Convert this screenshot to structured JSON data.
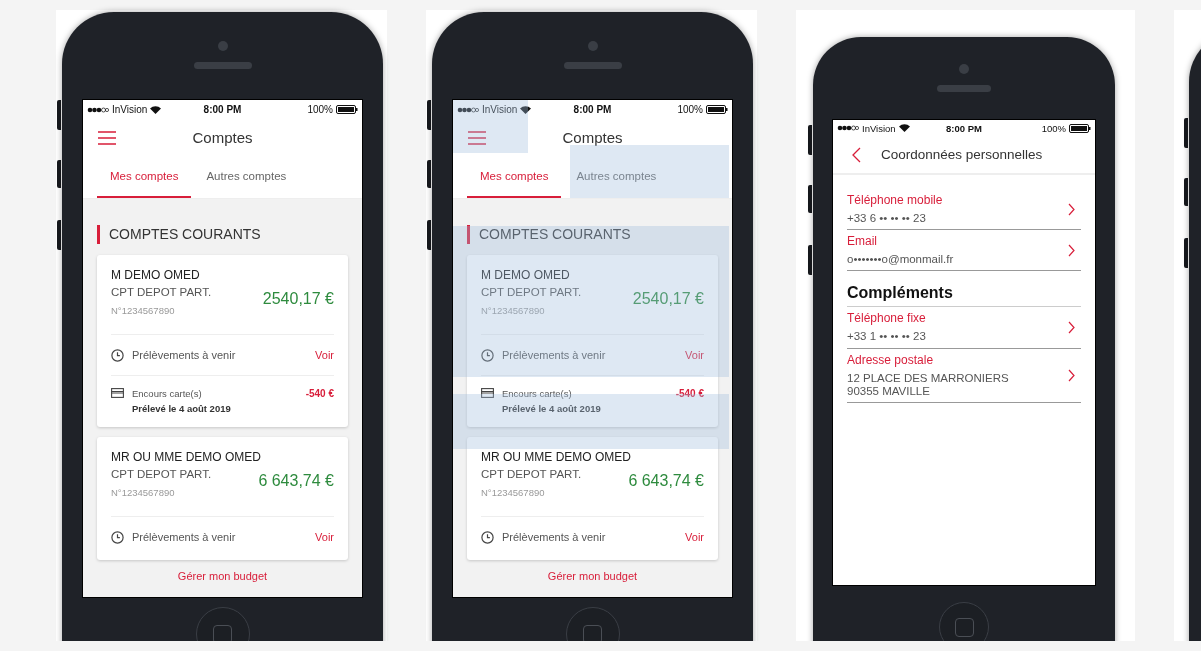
{
  "screens": [
    {
      "kind": "accounts",
      "hotspots_visible": false,
      "status": {
        "carrier": "InVision",
        "time": "8:00 PM",
        "battery": "100%"
      },
      "title": "Comptes",
      "tabs": [
        {
          "label": "Mes comptes",
          "selected": true
        },
        {
          "label": "Autres comptes",
          "selected": false
        }
      ],
      "section_title": "COMPTES COURANTS",
      "accounts": [
        {
          "holder": "M DEMO OMED",
          "type": "CPT DEPOT PART.",
          "balance": "2540,17 €",
          "number": "N°1234567890",
          "rows": [
            {
              "kind": "upcoming",
              "label": "Prélèvements à venir",
              "action": "Voir"
            },
            {
              "kind": "card",
              "label": "Encours carte(s)",
              "amount": "-540 €",
              "detail": "Prélevé le 4 août 2019"
            }
          ]
        },
        {
          "holder": "MR OU MME DEMO OMED",
          "type": "CPT DEPOT PART.",
          "balance": "6 643,74 €",
          "number": "N°1234567890",
          "rows": [
            {
              "kind": "upcoming",
              "label": "Prélèvements à venir",
              "action": "Voir"
            }
          ]
        }
      ],
      "footer_link": "Gérer mon budget"
    },
    {
      "kind": "accounts",
      "hotspots_visible": true,
      "status": {
        "carrier": "InVision",
        "time": "8:00 PM",
        "battery": "100%"
      },
      "title": "Comptes",
      "tabs": [
        {
          "label": "Mes comptes",
          "selected": true
        },
        {
          "label": "Autres comptes",
          "selected": false
        }
      ],
      "section_title": "COMPTES COURANTS",
      "accounts": [
        {
          "holder": "M DEMO OMED",
          "type": "CPT DEPOT PART.",
          "balance": "2540,17 €",
          "number": "N°1234567890",
          "rows": [
            {
              "kind": "upcoming",
              "label": "Prélèvements à venir",
              "action": "Voir"
            },
            {
              "kind": "card",
              "label": "Encours carte(s)",
              "amount": "-540 €",
              "detail": "Prélevé le 4 août 2019"
            }
          ]
        },
        {
          "holder": "MR OU MME DEMO OMED",
          "type": "CPT DEPOT PART.",
          "balance": "6 643,74 €",
          "number": "N°1234567890",
          "rows": [
            {
              "kind": "upcoming",
              "label": "Prélèvements à venir",
              "action": "Voir"
            }
          ]
        }
      ],
      "footer_link": "Gérer mon budget"
    },
    {
      "kind": "contact",
      "status": {
        "carrier": "InVision",
        "time": "8:00 PM",
        "battery": "100%"
      },
      "title": "Coordonnées personnelles",
      "items": [
        {
          "kind": "field",
          "label": "Téléphone mobile",
          "value": "+33 6 •• •• •• 23"
        },
        {
          "kind": "field",
          "label": "Email",
          "value": "o•••••••o@monmail.fr"
        },
        {
          "kind": "heading",
          "text": "Compléments"
        },
        {
          "kind": "field",
          "label": "Téléphone fixe",
          "value": "+33 1 •• •• •• 23"
        },
        {
          "kind": "field",
          "label": "Adresse postale",
          "value": "12 PLACE DES MARRONIERS\n90355 MAVILLE"
        }
      ]
    },
    {
      "kind": "cropped"
    }
  ]
}
